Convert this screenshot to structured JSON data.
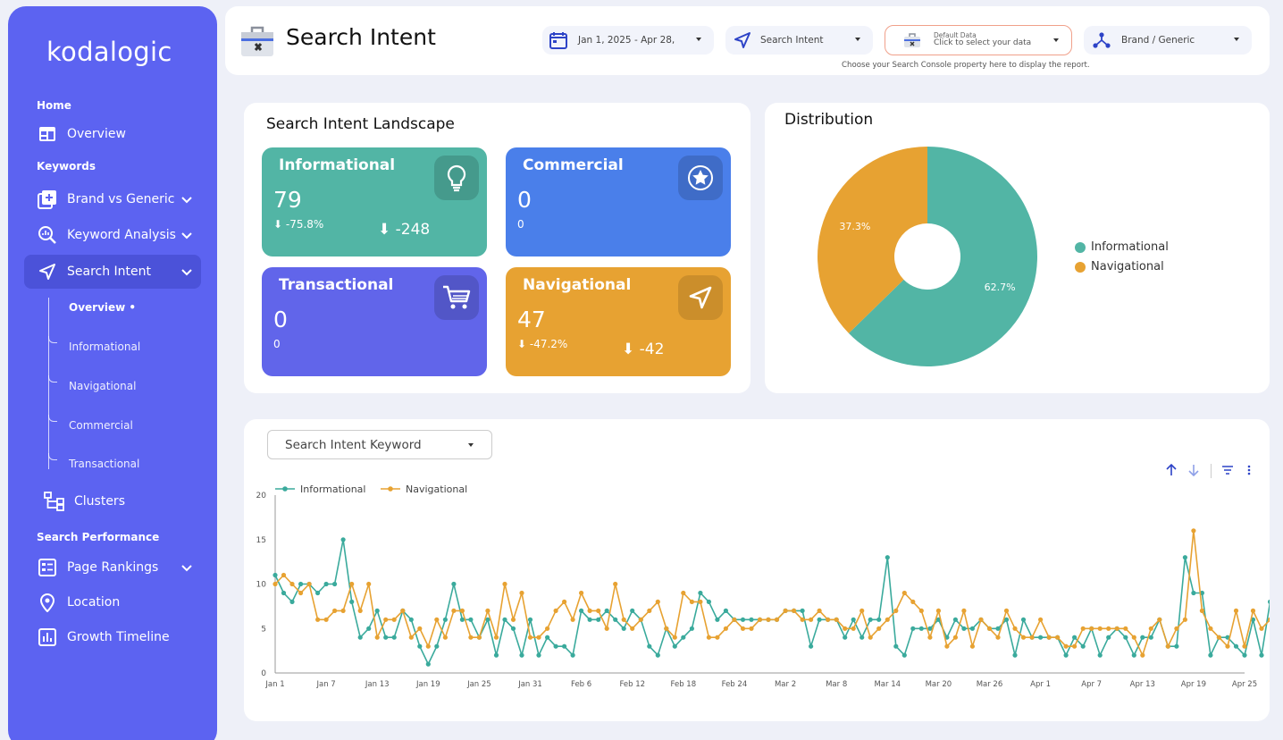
{
  "app": {
    "logo": "kodalogic"
  },
  "sidebar": {
    "sections": {
      "home": "Home",
      "keywords": "Keywords",
      "search_performance": "Search Performance"
    },
    "items": {
      "overview": "Overview",
      "brand_vs_generic": "Brand vs Generic",
      "keyword_analysis": "Keyword Analysis",
      "search_intent": "Search Intent",
      "clusters": "Clusters",
      "page_rankings": "Page Rankings",
      "location": "Location",
      "growth_timeline": "Growth Timeline"
    },
    "subitems": {
      "overview": "Overview •",
      "informational": "Informational",
      "navigational": "Navigational",
      "commercial": "Commercial",
      "transactional": "Transactional"
    }
  },
  "header": {
    "title": "Search Intent",
    "date_range": "Jan 1, 2025 - Apr 28,",
    "intent_filter": "Search Intent",
    "data_source_title": "Default Data",
    "data_source_sub": "Click to select your data",
    "brand_filter": "Brand / Generic",
    "hint": "Choose your Search Console property here to display the report."
  },
  "landscape": {
    "title": "Search Intent Landscape",
    "tiles": {
      "informational": {
        "title": "Informational",
        "value": "79",
        "pct": "⬇ -75.8%",
        "delta": "⬇ -248",
        "color": "#52b5a5",
        "icon": "lightbulb-icon"
      },
      "commercial": {
        "title": "Commercial",
        "value": "0",
        "pct": "0",
        "delta": "",
        "color": "#4a7fea",
        "icon": "star-icon"
      },
      "transactional": {
        "title": "Transactional",
        "value": "0",
        "pct": "0",
        "delta": "",
        "color": "#6165ea",
        "icon": "cart-icon"
      },
      "navigational": {
        "title": "Navigational",
        "value": "47",
        "pct": "⬇ -47.2%",
        "delta": "⬇ -42",
        "color": "#e7a232",
        "icon": "navigation-arrow-icon"
      }
    }
  },
  "distribution": {
    "title": "Distribution",
    "slices": [
      {
        "name": "Informational",
        "value": 62.7,
        "label": "62.7%",
        "color": "#52b5a5"
      },
      {
        "name": "Navigational",
        "value": 37.3,
        "label": "37.3%",
        "color": "#e7a232"
      }
    ]
  },
  "timeline": {
    "selector": "Search Intent Keyword"
  },
  "chart_data": {
    "type": "line",
    "title": "",
    "xlabel": "",
    "ylabel": "",
    "ylim": [
      0,
      20
    ],
    "yticks": [
      "0",
      "5",
      "10",
      "15",
      "20"
    ],
    "xticks": [
      "Jan 1",
      "Jan 7",
      "Jan 13",
      "Jan 19",
      "Jan 25",
      "Jan 31",
      "Feb 6",
      "Feb 12",
      "Feb 18",
      "Feb 24",
      "Mar 2",
      "Mar 8",
      "Mar 14",
      "Mar 20",
      "Mar 26",
      "Apr 1",
      "Apr 7",
      "Apr 13",
      "Apr 19",
      "Apr 25"
    ],
    "x_start": "Jan 1",
    "legend": "top-left",
    "series": [
      {
        "name": "Informational",
        "color": "#3aaa9c",
        "values": [
          11,
          9,
          8,
          10,
          10,
          9,
          10,
          10,
          15,
          8,
          4,
          5,
          7,
          4,
          4,
          7,
          6,
          3,
          1,
          3,
          6,
          10,
          6,
          6,
          4,
          6,
          2,
          6,
          5,
          2,
          6,
          2,
          4,
          3,
          3,
          2,
          7,
          6,
          6,
          7,
          6,
          5,
          7,
          6,
          3,
          2,
          5,
          3,
          4,
          5,
          9,
          8,
          6,
          7,
          6,
          6,
          6,
          6,
          6,
          6,
          7,
          7,
          7,
          3,
          6,
          6,
          6,
          4,
          6,
          4,
          6,
          6,
          13,
          3,
          2,
          5,
          5,
          5,
          6,
          4,
          6,
          5,
          5,
          6,
          5,
          5,
          6,
          2,
          6,
          4,
          4,
          4,
          4,
          2,
          4,
          3,
          5,
          2,
          4,
          5,
          4,
          2,
          4,
          4,
          6,
          3,
          3,
          13,
          9,
          9,
          2,
          4,
          4,
          3,
          2,
          6,
          2,
          8,
          4,
          5,
          8
        ]
      },
      {
        "name": "Navigational",
        "color": "#e7a232",
        "values": [
          10,
          11,
          10,
          9,
          10,
          6,
          6,
          7,
          7,
          10,
          7,
          10,
          4,
          6,
          6,
          7,
          4,
          5,
          3,
          6,
          4,
          7,
          7,
          4,
          4,
          7,
          4,
          10,
          6,
          9,
          4,
          4,
          5,
          7,
          8,
          6,
          9,
          7,
          7,
          5,
          10,
          6,
          5,
          6,
          7,
          8,
          5,
          4,
          9,
          8,
          8,
          4,
          4,
          5,
          6,
          5,
          5,
          6,
          6,
          6,
          7,
          7,
          6,
          6,
          7,
          6,
          6,
          5,
          5,
          7,
          4,
          5,
          6,
          7,
          9,
          8,
          7,
          4,
          7,
          3,
          4,
          7,
          3,
          6,
          5,
          4,
          7,
          5,
          4,
          4,
          6,
          4,
          4,
          3,
          3,
          5,
          5,
          5,
          5,
          5,
          5,
          4,
          2,
          5,
          6,
          3,
          5,
          6,
          16,
          7,
          5,
          4,
          3,
          7,
          3,
          7,
          5,
          6,
          5,
          5,
          6
        ]
      }
    ]
  }
}
